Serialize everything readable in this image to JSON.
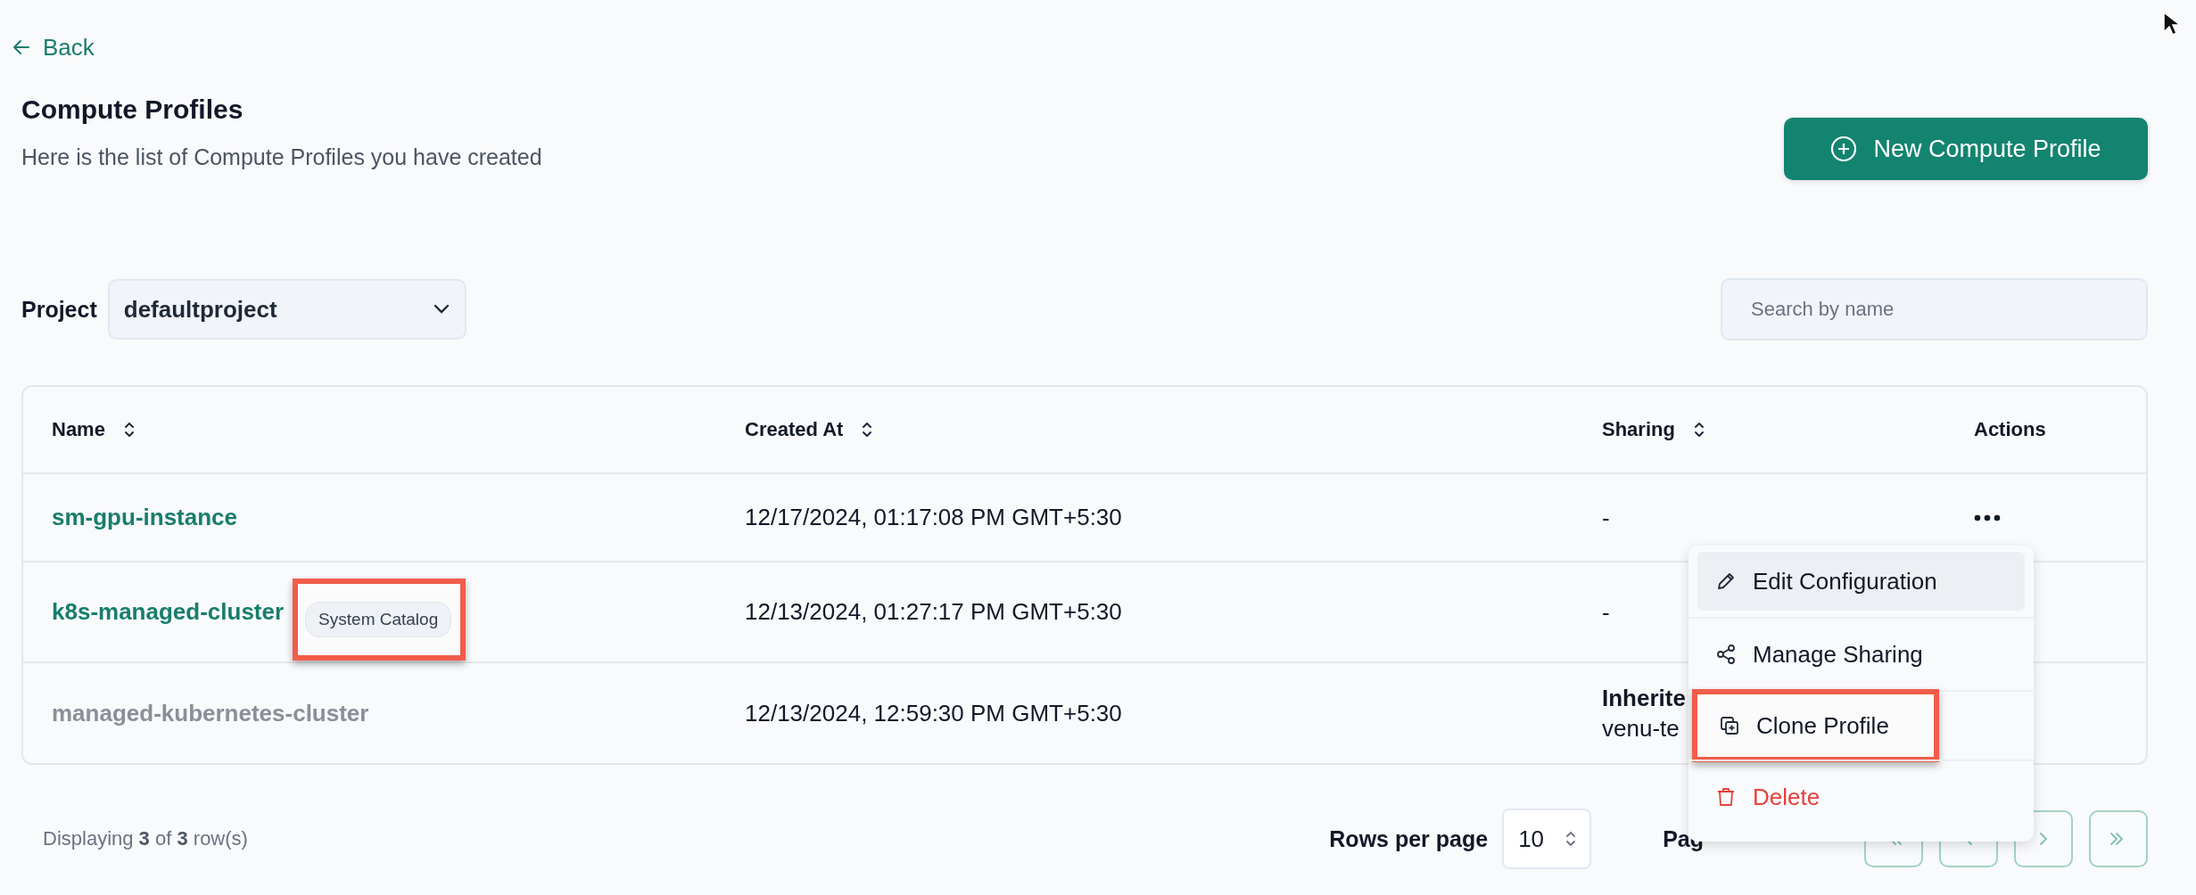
{
  "back": {
    "label": "Back"
  },
  "header": {
    "title": "Compute Profiles",
    "subtitle": "Here is the list of Compute Profiles you have created",
    "action": "New Compute Profile"
  },
  "filters": {
    "project_label": "Project",
    "project_value": "defaultproject",
    "search": {
      "placeholder": "Search by name"
    }
  },
  "table": {
    "columns": [
      {
        "label": "Name",
        "sortable": true
      },
      {
        "label": "Created At",
        "sortable": true
      },
      {
        "label": "Sharing",
        "sortable": true
      },
      {
        "label": "Actions",
        "sortable": false
      }
    ],
    "rows": [
      {
        "name": "sm-gpu-instance",
        "disabled": false,
        "created_at": "12/17/2024, 01:17:08 PM GMT+5:30",
        "sharing": [
          {
            "text": "-",
            "bold": false
          }
        ],
        "actions_visible": true
      },
      {
        "name": "k8s-managed-cluster",
        "disabled": false,
        "badge": {
          "label": "System Catalog",
          "annotated": true
        },
        "created_at": "12/13/2024, 01:27:17 PM GMT+5:30",
        "sharing": [
          {
            "text": "-",
            "bold": false
          }
        ],
        "actions_visible": false
      },
      {
        "name": "managed-kubernetes-cluster",
        "disabled": true,
        "created_at": "12/13/2024, 12:59:30 PM GMT+5:30",
        "sharing": [
          {
            "text": "Inherite",
            "bold": true
          },
          {
            "text": "venu-te",
            "bold": false
          }
        ],
        "actions_visible": false
      }
    ]
  },
  "menu": {
    "items": [
      {
        "label": "Edit Configuration",
        "kind": "edit",
        "selected": true,
        "danger": false,
        "annotated": false
      },
      {
        "label": "Manage Sharing",
        "kind": "share",
        "selected": false,
        "danger": false,
        "annotated": false
      },
      {
        "label": "Clone Profile",
        "kind": "clone",
        "selected": false,
        "danger": false,
        "annotated": true
      },
      {
        "label": "Delete",
        "kind": "delete",
        "selected": false,
        "danger": true,
        "annotated": false
      }
    ]
  },
  "footer": {
    "summary": "Displaying **3** of **3** row(s)",
    "rows_per_page_label": "Rows per page",
    "rows_per_page": "10",
    "page_label": "Pag",
    "pager": [
      {
        "kind": "first"
      },
      {
        "kind": "prev"
      },
      {
        "kind": "next"
      },
      {
        "kind": "last"
      }
    ]
  }
}
